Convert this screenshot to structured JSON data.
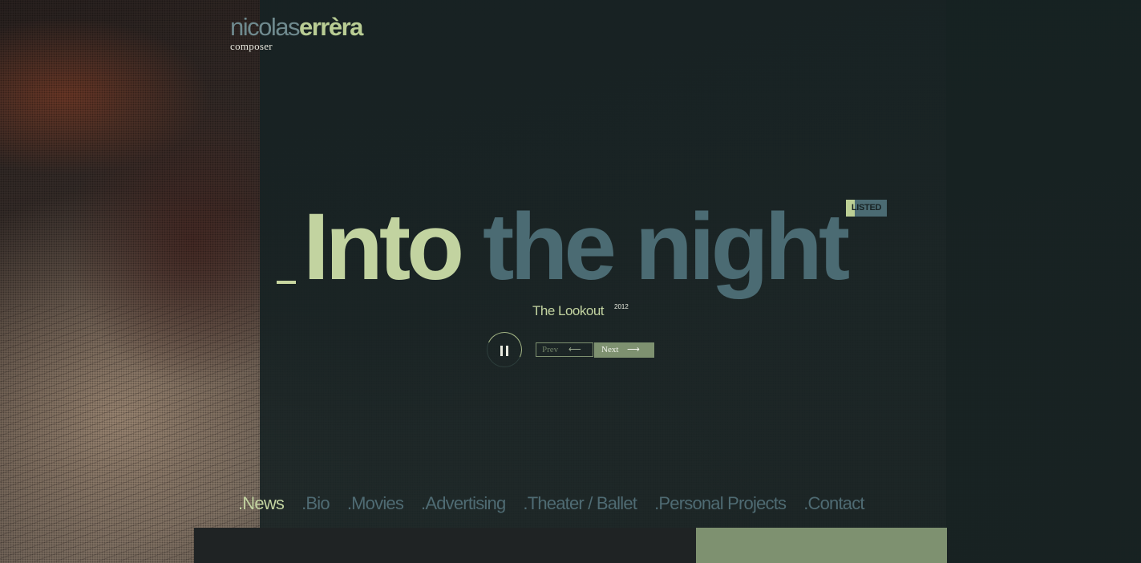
{
  "logo": {
    "first": "nicolas",
    "last": "errèra",
    "subtitle": "composer"
  },
  "hero": {
    "title_lit": "Into",
    "title_dim": " the night",
    "badge": "LISTED",
    "album": "The Lookout",
    "year": "2012"
  },
  "player": {
    "pause_icon": "pause-icon",
    "prev_label": "Prev",
    "prev_arrow": "⟵",
    "next_label": "Next",
    "next_arrow": "⟶"
  },
  "nav": {
    "items": [
      {
        "label": ".News"
      },
      {
        "label": ".Bio"
      },
      {
        "label": ".Movies"
      },
      {
        "label": ".Advertising"
      },
      {
        "label": ".Theater / Ballet"
      },
      {
        "label": ".Personal Projects"
      },
      {
        "label": ".Contact"
      }
    ]
  },
  "colors": {
    "accent": "#c2d3a0",
    "muted": "#4b6b73",
    "panel": "#172223",
    "button_green": "#7e9170"
  }
}
